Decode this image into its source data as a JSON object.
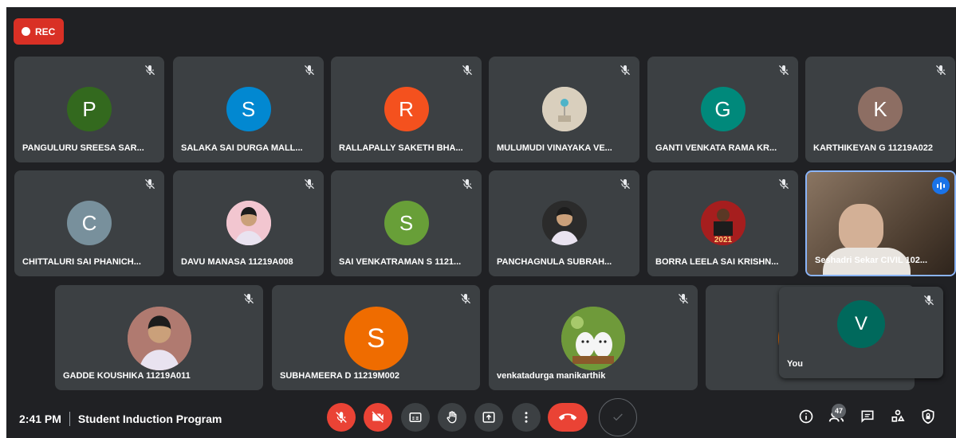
{
  "recording": {
    "label": "REC"
  },
  "participants": [
    {
      "initial": "P",
      "color": "#33691e",
      "name": "PANGULURU SREESA SAR..."
    },
    {
      "initial": "S",
      "color": "#0288d1",
      "name": "SALAKA SAI DURGA MALL..."
    },
    {
      "initial": "R",
      "color": "#f4511e",
      "name": "RALLAPALLY SAKETH BHA..."
    },
    {
      "initial": "",
      "color": "#d9cfbd",
      "name": "MULUMUDI VINAYAKA VE...",
      "photo": "balloon-photo"
    },
    {
      "initial": "G",
      "color": "#00897b",
      "name": "GANTI VENKATA RAMA KR..."
    },
    {
      "initial": "K",
      "color": "#8d6e63",
      "name": "KARTHIKEYAN G 11219A022"
    },
    {
      "initial": "C",
      "color": "#78909c",
      "name": "CHITTALURI SAI PHANICH..."
    },
    {
      "initial": "",
      "color": "#f2c6d0",
      "name": "DAVU MANASA 11219A008",
      "photo": "person-photo"
    },
    {
      "initial": "S",
      "color": "#689f38",
      "name": "SAI VENKATRAMAN S 1121..."
    },
    {
      "initial": "",
      "color": "#2b2b2b",
      "name": "PANCHAGNULA SUBRAH...",
      "photo": "person-photo"
    },
    {
      "initial": "",
      "color": "#a61e1e",
      "name": "BORRA LEELA SAI KRISHN...",
      "photo": "cricket-photo",
      "photo_text": "2021"
    },
    {
      "initial": "",
      "color": "#6b5a4a",
      "name": "Seshadri Sekar CIVIL 102...",
      "photo": "camera-video",
      "speaking": true
    },
    {
      "initial": "",
      "color": "#b07a70",
      "name": "GADDE KOUSHIKA 11219A011",
      "photo": "person-photo"
    },
    {
      "initial": "S",
      "color": "#ef6c00",
      "name": "SUBHAMEERA D 11219M002"
    },
    {
      "initial": "",
      "color": "#6f9a3a",
      "name": "venkatadurga manikarthik",
      "photo": "puppies-photo"
    },
    {
      "initial": "",
      "color": "#ef6c00",
      "name": ""
    }
  ],
  "self_view": {
    "initial": "V",
    "color": "#00695c",
    "name": "You"
  },
  "bottom_bar": {
    "time": "2:41 PM",
    "meeting_title": "Student Induction Program",
    "controls": [
      "mic-off-icon",
      "camera-off-icon",
      "captions-icon",
      "raise-hand-icon",
      "present-icon",
      "more-options-icon",
      "end-call-icon",
      "checkmark-icon"
    ],
    "people_count": "47",
    "right_icons": [
      "info-icon",
      "people-icon",
      "chat-icon",
      "activities-icon",
      "host-controls-icon"
    ]
  }
}
